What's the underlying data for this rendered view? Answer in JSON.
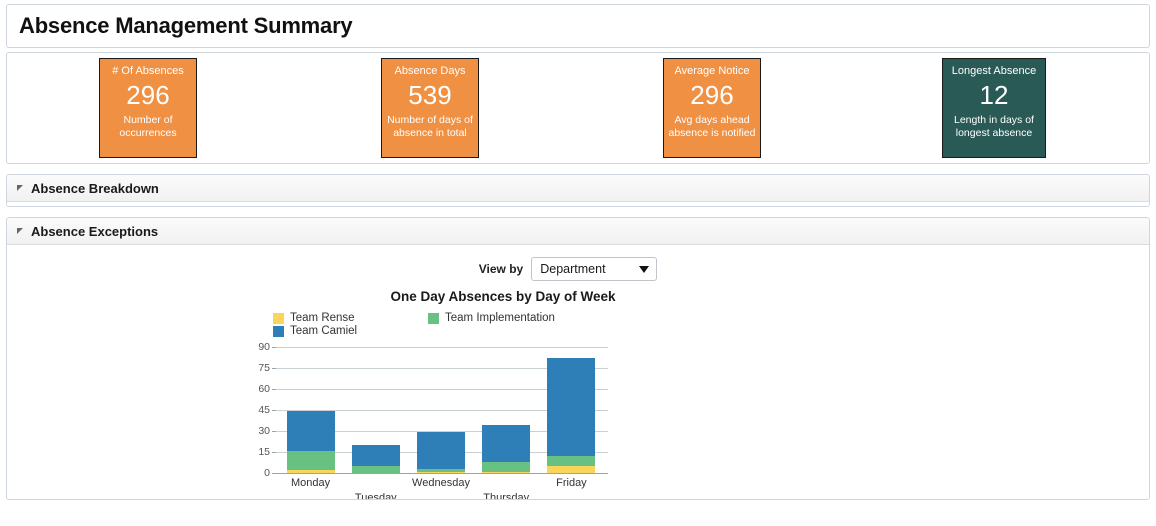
{
  "header": {
    "title": "Absence Management Summary"
  },
  "kpis": [
    {
      "label": "# Of Absences",
      "value": "296",
      "desc": "Number of occurrences",
      "color": "#EF9043",
      "text_color": "#FFFFFF"
    },
    {
      "label": "Absence Days",
      "value": "539",
      "desc": "Number of days of absence in total",
      "color": "#EF9043",
      "text_color": "#FFFFFF"
    },
    {
      "label": "Average Notice",
      "value": "296",
      "desc": "Avg days ahead absence is notified",
      "color": "#EF9043",
      "text_color": "#FFFFFF"
    },
    {
      "label": "Longest Absence",
      "value": "12",
      "desc": "Length in days of longest absence",
      "color": "#2A5A56",
      "text_color": "#FFFFFF"
    }
  ],
  "sections": [
    {
      "title": "Absence Breakdown",
      "expanded": true
    },
    {
      "title": "Absence Exceptions",
      "expanded": true
    }
  ],
  "controls": {
    "view_by_label": "View by",
    "view_by_value": "Department",
    "view_by_options": [
      "Department"
    ],
    "caret_icon": "chevron-down-icon"
  },
  "chart_data": {
    "type": "bar",
    "stacked": true,
    "title": "One Day Absences by Day of Week",
    "xlabel": "",
    "ylabel": "",
    "categories": [
      "Monday",
      "Tuesday",
      "Wednesday",
      "Thursday",
      "Friday"
    ],
    "series": [
      {
        "name": "Team Rense",
        "color": "#FAD55C",
        "values": [
          2,
          0,
          1,
          1,
          5
        ]
      },
      {
        "name": "Team Implementation",
        "color": "#68C182",
        "values": [
          14,
          5,
          2,
          7,
          7
        ]
      },
      {
        "name": "Team Camiel",
        "color": "#2E7EB8",
        "values": [
          28,
          15,
          26,
          26,
          70
        ]
      }
    ],
    "totals": [
      44,
      20,
      29,
      34,
      82
    ],
    "ylim": [
      0,
      90
    ],
    "yticks": [
      "0",
      "15",
      "30",
      "45",
      "60",
      "75",
      "90"
    ],
    "grid": true,
    "legend_position": "top"
  }
}
